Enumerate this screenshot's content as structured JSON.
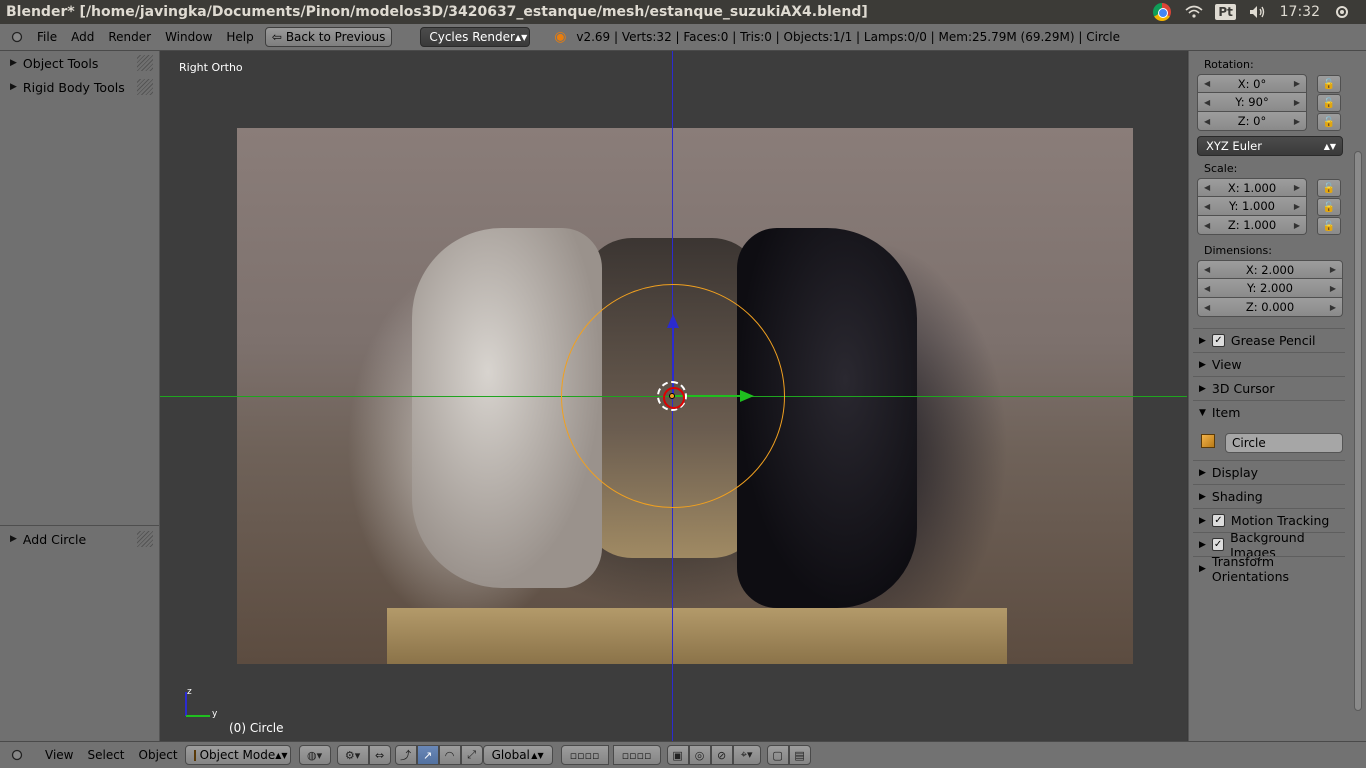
{
  "os": {
    "window_title": "Blender* [/home/javingka/Documents/Pinon/modelos3D/3420637_estanque/mesh/estanque_suzukiAX4.blend]",
    "keyboard_layout": "Pt",
    "clock": "17:32"
  },
  "info_header": {
    "menus": [
      "File",
      "Add",
      "Render",
      "Window",
      "Help"
    ],
    "back_button": "Back to Previous",
    "render_engine": "Cycles Render",
    "stats": "v2.69 | Verts:32 | Faces:0 | Tris:0 | Objects:1/1 | Lamps:0/0 | Mem:25.79M (69.29M) | Circle"
  },
  "toolshelf": {
    "panels": [
      "Object Tools",
      "Rigid Body Tools"
    ],
    "operator_panel": "Add Circle"
  },
  "viewport": {
    "view_name": "Right Ortho",
    "object_label": "(0) Circle",
    "axis_z": "z",
    "axis_y": "y"
  },
  "properties": {
    "rotation_label": "Rotation:",
    "rotation": [
      "X: 0°",
      "Y: 90°",
      "Z: 0°"
    ],
    "rotation_mode": "XYZ Euler",
    "scale_label": "Scale:",
    "scale": [
      "X: 1.000",
      "Y: 1.000",
      "Z: 1.000"
    ],
    "dimensions_label": "Dimensions:",
    "dimensions": [
      "X: 2.000",
      "Y: 2.000",
      "Z: 0.000"
    ],
    "panels": {
      "grease_pencil": "Grease Pencil",
      "view": "View",
      "cursor": "3D Cursor",
      "item": "Item",
      "display": "Display",
      "shading": "Shading",
      "motion_tracking": "Motion Tracking",
      "background_images": "Background Images",
      "transform_orientations": "Transform Orientations"
    },
    "item_name": "Circle"
  },
  "view_header": {
    "menus": [
      "View",
      "Select",
      "Object"
    ],
    "mode": "Object Mode",
    "orientation": "Global"
  },
  "colors": {
    "selection": "#f0a020",
    "axis_z": "#2b2bd0",
    "axis_y": "#1fa51f"
  }
}
